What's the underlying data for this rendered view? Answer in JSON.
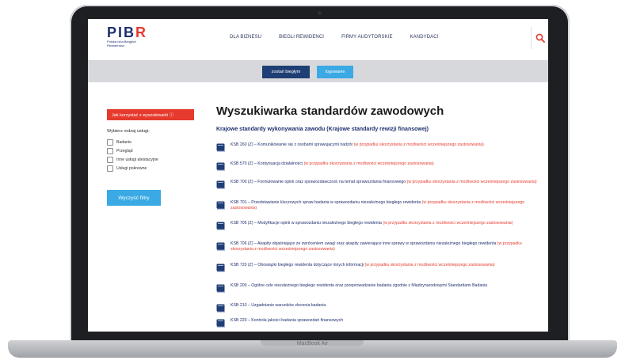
{
  "device": {
    "label": "MacBook Air"
  },
  "header": {
    "logo": {
      "word_main": "PIB",
      "word_accent": "R",
      "subtitle": "Polska Izba Biegłych Rewidentów"
    },
    "nav": [
      "DLA BIZNESU",
      "BIEGLI REWIDENCI",
      "FIRMY AUDYTORSKIE",
      "KANDYDACI"
    ],
    "search_icon": "search-icon"
  },
  "action_bar": {
    "primary_label": "zostań biegłym",
    "secondary_label": "logowanie"
  },
  "sidebar": {
    "how_to_label": "Jak korzystać z wyszukiwarki ⓘ",
    "heading": "Wybierz rodzaj usługi:",
    "filters": [
      "Badanie",
      "Przegląd",
      "Inne usługi atestacyjne",
      "Usługi pokrewne"
    ],
    "clear_label": "Wyczyść filtry"
  },
  "main": {
    "title": "Wyszukiwarka standardów zawodowych",
    "section": "Krajowe standardy wykonywania zawodu (Krajowe standardy rewizji finansowej)",
    "items": [
      {
        "text": "KSB 260 (Z) – Komunikowanie się z osobami sprawującymi nadzór ",
        "note": "(w przypadku skorzystania z możliwości wcześniejszego zastosowania)"
      },
      {
        "text": "KSB 570 (Z) – Kontynuacja działalności ",
        "note": "(w przypadku skorzystania z możliwości wcześniejszego zastosowania)"
      },
      {
        "text": "KSB 700 (Z) – Formułowanie opinii oraz sprawozdawczość na temat sprawozdania finansowego ",
        "note": "(w przypadku skorzystania z możliwości wcześniejszego zastosowania)"
      },
      {
        "text": "KSB 701 – Przedstawianie kluczowych spraw badania w sprawozdaniu niezależnego biegłego rewidenta ",
        "note": "(w przypadku skorzystania z możliwości wcześniejszego zastosowania)"
      },
      {
        "text": "KSB 705 (Z) – Modyfikacje opinii w sprawozdaniu niezależnego biegłego rewidenta ",
        "note": "(w przypadku skorzystania z możliwości wcześniejszego zastosowania)"
      },
      {
        "text": "KSB 706 (Z) – Akapity objaśniające ze zwróceniem uwagi oraz akapity zawierające inne sprawy w sprawozdaniu niezależnego biegłego rewidenta ",
        "note": "(w przypadku skorzystania z możliwości wcześniejszego zastosowania)"
      },
      {
        "text": "KSB 720 (Z) – Obowiązki biegłego rewidenta dotyczące innych informacji ",
        "note": "(w przypadku skorzystania z możliwości wcześniejszego zastosowania)"
      },
      {
        "text": "KSB 200 – Ogólne cele niezależnego biegłego rewidenta oraz przeprowadzanie badania zgodnie z Międzynarodowymi Standardami Badania",
        "note": ""
      },
      {
        "text": "KSB 210 – Uzgadnianie warunków zlecenia badania",
        "note": ""
      },
      {
        "text": "KSB 220 – Kontrola jakości badania sprawozdań finansowych",
        "note": ""
      }
    ]
  },
  "colors": {
    "navy": "#1f2f6e",
    "red": "#e63a2e",
    "blue": "#3aa9e4",
    "dark_blue": "#1f3e73",
    "grey_bar": "#d6d8dc"
  }
}
